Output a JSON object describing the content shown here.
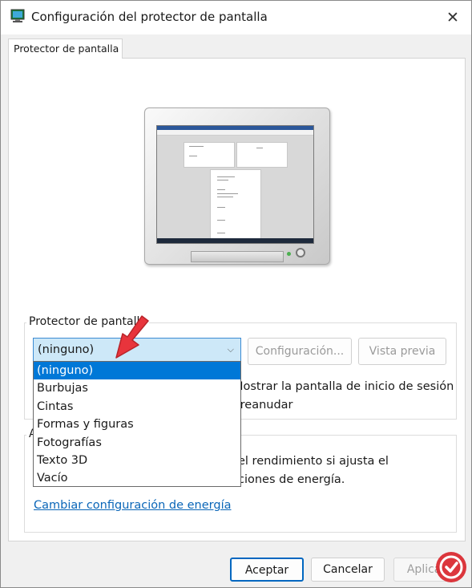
{
  "window": {
    "title": "Configuración del protector de pantalla",
    "close_glyph": "✕"
  },
  "tabs": [
    {
      "label": "Protector de pantalla"
    }
  ],
  "screensaver_group": {
    "label": "Protector de pantalla",
    "selected_value": "(ninguno)",
    "settings_button": "Configuración...",
    "preview_button": "Vista previa",
    "options": [
      "(ninguno)",
      "Burbujas",
      "Cintas",
      "Formas y figuras",
      "Fotografías",
      "Texto 3D",
      "Vacío"
    ],
    "resume_text_line1": "Mostrar la pantalla de inicio de sesión",
    "resume_text_line2": "l reanudar"
  },
  "power_group": {
    "label_fragment": "A",
    "text_line1": "el rendimiento si ajusta el",
    "text_line2": "ciones de energía.",
    "link": "Cambiar configuración de energía"
  },
  "footer": {
    "ok": "Aceptar",
    "cancel": "Cancelar",
    "apply": "Aplicar"
  },
  "colors": {
    "accent": "#0078d7",
    "link": "#0a66b8",
    "select_bg": "#cde8f8",
    "arrow": "#e8343c"
  },
  "icons": {
    "app": "monitor-screensaver-icon",
    "close": "close-icon",
    "dropdown": "chevron-down-icon",
    "annotation": "red-arrow-icon",
    "watermark": "site-logo-icon"
  }
}
